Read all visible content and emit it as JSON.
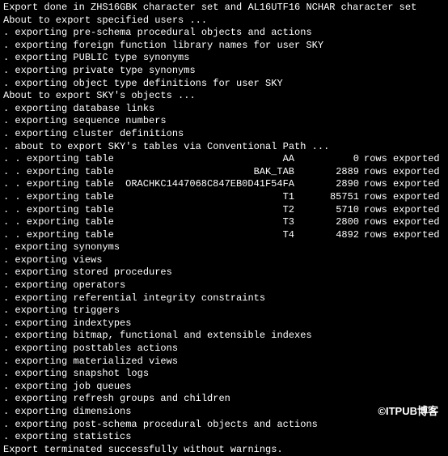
{
  "header": "Export done in ZHS16GBK character set and AL16UTF16 NCHAR character set",
  "blank1": "",
  "about_users": "About to export specified users ...",
  "pre_objects": [
    ". exporting pre-schema procedural objects and actions",
    ". exporting foreign function library names for user SKY",
    ". exporting PUBLIC type synonyms",
    ". exporting private type synonyms",
    ". exporting object type definitions for user SKY"
  ],
  "about_sky": "About to export SKY's objects ...",
  "sky_pre": [
    ". exporting database links",
    ". exporting sequence numbers",
    ". exporting cluster definitions",
    ". about to export SKY's tables via Conventional Path ..."
  ],
  "table_prefix": ". . exporting table",
  "rows_suffix": "rows exported",
  "tables": [
    {
      "name": "AA",
      "rows": "0"
    },
    {
      "name": "BAK_TAB",
      "rows": "2889"
    },
    {
      "name": "ORACHKC1447068C847EB0D41F54FA",
      "rows": "2890"
    },
    {
      "name": "T1",
      "rows": "85751"
    },
    {
      "name": "T2",
      "rows": "5710"
    },
    {
      "name": "T3",
      "rows": "2800"
    },
    {
      "name": "T4",
      "rows": "4892"
    }
  ],
  "post_objects": [
    ". exporting synonyms",
    ". exporting views",
    ". exporting stored procedures",
    ". exporting operators",
    ". exporting referential integrity constraints",
    ". exporting triggers",
    ". exporting indextypes",
    ". exporting bitmap, functional and extensible indexes",
    ". exporting posttables actions",
    ". exporting materialized views",
    ". exporting snapshot logs",
    ". exporting job queues",
    ". exporting refresh groups and children",
    ". exporting dimensions",
    ". exporting post-schema procedural objects and actions",
    ". exporting statistics"
  ],
  "footer": "Export terminated successfully without warnings.",
  "watermark": "©ITPUB博客"
}
